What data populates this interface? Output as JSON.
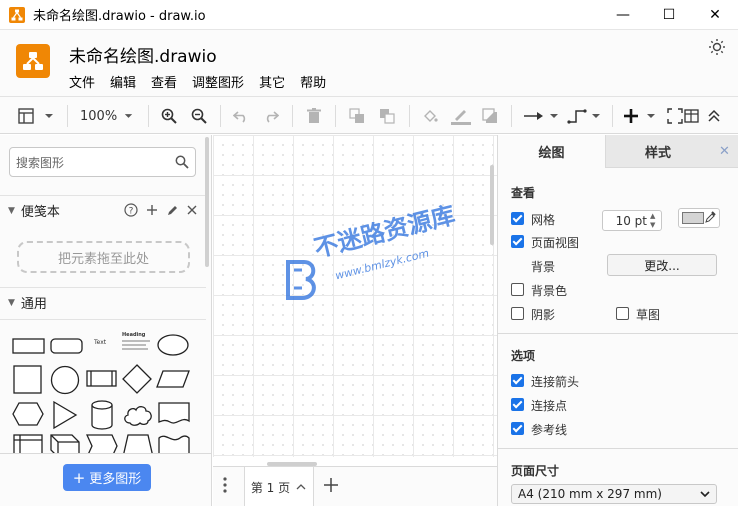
{
  "window": {
    "title": "未命名绘图.drawio - draw.io",
    "min_glyph": "—",
    "max_glyph": "☐",
    "close_glyph": "✕"
  },
  "app": {
    "doc_title": "未命名绘图.drawio",
    "menus": [
      "文件",
      "编辑",
      "查看",
      "调整图形",
      "其它",
      "帮助"
    ]
  },
  "toolbar": {
    "zoom": "100%"
  },
  "left_panel": {
    "search_placeholder": "搜索图形",
    "scratchpad_label": "便笺本",
    "dropzone_text": "把元素拖至此处",
    "general_label": "通用",
    "more_shapes_label": "更多图形",
    "shape_text_sample": "Text",
    "shape_heading_sample": "Heading"
  },
  "page_bar": {
    "page_tab": "第 1 页"
  },
  "watermark": {
    "text": "不迷路资源库",
    "url": "www.bmlzyk.com"
  },
  "right_panel": {
    "tabs": [
      "绘图",
      "样式"
    ],
    "close_glyph": "✕",
    "view_section": "查看",
    "grid_label": "网格",
    "grid_checked": true,
    "grid_size": "10 pt",
    "grid_color": "#d4d4d4",
    "page_view_label": "页面视图",
    "page_view_checked": true,
    "background_label": "背景",
    "change_button": "更改...",
    "bg_color_label": "背景色",
    "bg_color_checked": false,
    "shadow_label": "阴影",
    "shadow_checked": false,
    "sketch_label": "草图",
    "sketch_checked": false,
    "options_section": "选项",
    "connect_arrows_label": "连接箭头",
    "connect_arrows_checked": true,
    "connect_points_label": "连接点",
    "connect_points_checked": true,
    "guides_label": "参考线",
    "guides_checked": true,
    "page_size_section": "页面尺寸",
    "paper_size": "A4 (210 mm x 297 mm)"
  },
  "colors": {
    "drawio_orange": "#f08705",
    "accent_blue": "#4b87f0",
    "checkbox_blue": "#1a73e8"
  }
}
